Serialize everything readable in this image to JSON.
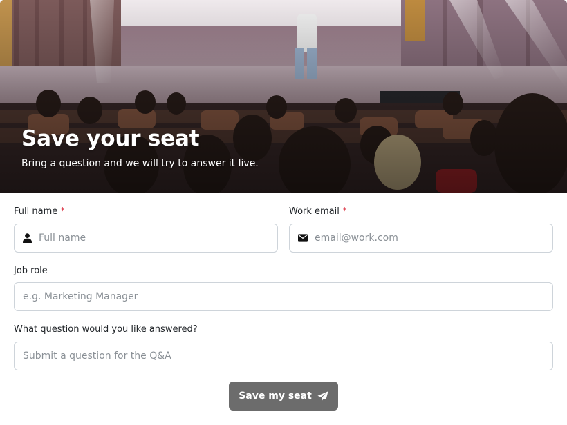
{
  "hero": {
    "title": "Save your seat",
    "subtitle": "Bring a question and we will try to answer it live."
  },
  "form": {
    "full_name": {
      "label": "Full name",
      "required_mark": "*",
      "placeholder": "Full name",
      "icon": "user-icon"
    },
    "work_email": {
      "label": "Work email",
      "required_mark": "*",
      "placeholder": "email@work.com",
      "icon": "envelope-icon"
    },
    "job_role": {
      "label": "Job role",
      "placeholder": "e.g. Marketing Manager"
    },
    "question": {
      "label": "What question would you like answered?",
      "placeholder": "Submit a question for the Q&A"
    },
    "submit": {
      "label": "Save my seat",
      "icon": "paper-plane-icon"
    }
  },
  "colors": {
    "required": "#dc3545",
    "button_bg": "#6c6c6c",
    "input_border": "#ced4da"
  }
}
